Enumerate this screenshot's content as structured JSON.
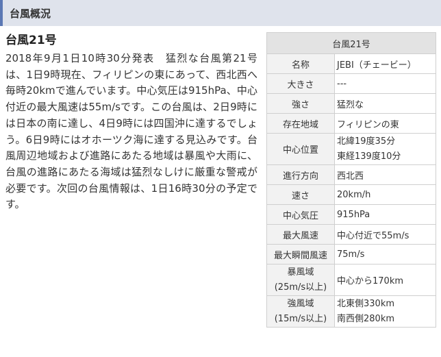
{
  "section": {
    "title": "台風概況"
  },
  "typhoon": {
    "title": "台風21号",
    "report": "2018年9月1日10時30分発表　猛烈な台風第21号は、1日9時現在、フィリピンの東にあって、西北西へ毎時20kmで進んでいます。中心気圧は915hPa、中心付近の最大風速は55m/sです。この台風は、2日9時には日本の南に達し、4日9時には四国沖に達するでしょう。6日9時にはオホーツク海に達する見込みです。台風周辺地域および進路にあたる地域は暴風や大雨に、台風の進路にあたる海域は猛烈なしけに厳重な警戒が必要です。次回の台風情報は、1日16時30分の予定です。"
  },
  "table": {
    "caption": "台風21号",
    "rows": [
      {
        "label": "名称",
        "value": "JEBI（チェービー）"
      },
      {
        "label": "大きさ",
        "value": "---"
      },
      {
        "label": "強さ",
        "value": "猛烈な"
      },
      {
        "label": "存在地域",
        "value": "フィリピンの東"
      },
      {
        "label": "中心位置",
        "values": [
          "北緯19度35分",
          "東経139度10分"
        ]
      },
      {
        "label": "進行方向",
        "value": "西北西"
      },
      {
        "label": "速さ",
        "value": "20km/h"
      },
      {
        "label": "中心気圧",
        "value": "915hPa"
      },
      {
        "label": "最大風速",
        "value": "中心付近で55m/s"
      },
      {
        "label": "最大瞬間風速",
        "value": "75m/s"
      },
      {
        "labels": [
          "暴風域",
          "(25m/s以上)"
        ],
        "value": "中心から170km"
      },
      {
        "labels": [
          "強風域",
          "(15m/s以上)"
        ],
        "values": [
          "北東側330km",
          "南西側280km"
        ]
      }
    ]
  }
}
